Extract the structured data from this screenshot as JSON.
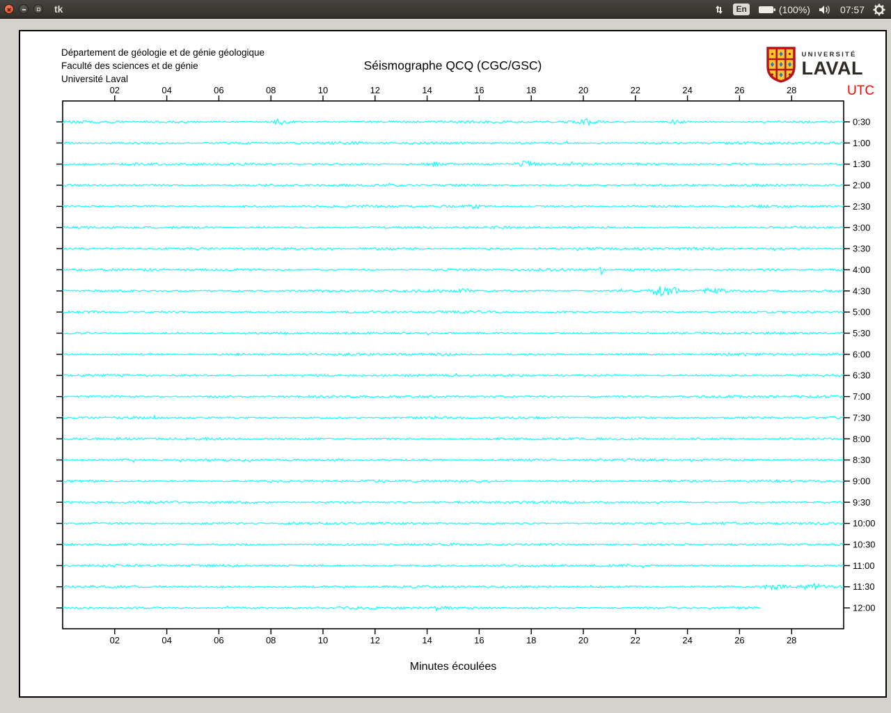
{
  "titlebar": {
    "title": "tk",
    "tray": {
      "keyboard_indicator": "En",
      "battery_label": "(100%)",
      "clock": "07:57"
    }
  },
  "header": {
    "institution_lines": [
      "Département de géologie et de génie géologique",
      "Faculté des sciences et de génie",
      "Université Laval"
    ],
    "logo": {
      "top": "UNIVERSITÉ",
      "bottom": "LAVAL"
    }
  },
  "chart_data": {
    "type": "line",
    "title": "Séismographe QCQ (CGC/GSC)",
    "xlabel": "Minutes écoulées",
    "right_axis_label": "UTC",
    "right_axis_label_color": "#ff0000",
    "trace_color": "#00ffff",
    "axis_color": "#000000",
    "x_range": [
      0,
      30
    ],
    "x_ticks": [
      "02",
      "04",
      "06",
      "08",
      "10",
      "12",
      "14",
      "16",
      "18",
      "20",
      "22",
      "24",
      "26",
      "28"
    ],
    "grid": false,
    "traces": [
      {
        "label": "0:30",
        "end_minute": 30
      },
      {
        "label": "1:00",
        "end_minute": 30
      },
      {
        "label": "1:30",
        "end_minute": 30
      },
      {
        "label": "2:00",
        "end_minute": 30
      },
      {
        "label": "2:30",
        "end_minute": 30
      },
      {
        "label": "3:00",
        "end_minute": 30
      },
      {
        "label": "3:30",
        "end_minute": 30
      },
      {
        "label": "4:00",
        "end_minute": 30
      },
      {
        "label": "4:30",
        "end_minute": 30
      },
      {
        "label": "5:00",
        "end_minute": 30
      },
      {
        "label": "5:30",
        "end_minute": 30
      },
      {
        "label": "6:00",
        "end_minute": 30
      },
      {
        "label": "6:30",
        "end_minute": 30
      },
      {
        "label": "7:00",
        "end_minute": 30
      },
      {
        "label": "7:30",
        "end_minute": 30
      },
      {
        "label": "8:00",
        "end_minute": 30
      },
      {
        "label": "8:30",
        "end_minute": 30
      },
      {
        "label": "9:00",
        "end_minute": 30
      },
      {
        "label": "9:30",
        "end_minute": 30
      },
      {
        "label": "10:00",
        "end_minute": 30
      },
      {
        "label": "10:30",
        "end_minute": 30
      },
      {
        "label": "11:00",
        "end_minute": 30
      },
      {
        "label": "11:30",
        "end_minute": 30
      },
      {
        "label": "12:00",
        "end_minute": 26.8
      }
    ],
    "events": [
      {
        "trace": 0,
        "minute": 8.4,
        "amp": 3.5,
        "sigma": 0.22
      },
      {
        "trace": 0,
        "minute": 20.2,
        "amp": 3.0,
        "sigma": 0.25
      },
      {
        "trace": 0,
        "minute": 23.5,
        "amp": 2.5,
        "sigma": 0.2
      },
      {
        "trace": 2,
        "minute": 14.2,
        "amp": 2.5,
        "sigma": 0.2
      },
      {
        "trace": 2,
        "minute": 17.8,
        "amp": 3.5,
        "sigma": 0.25
      },
      {
        "trace": 4,
        "minute": 15.8,
        "amp": 2.5,
        "sigma": 0.2
      },
      {
        "trace": 7,
        "minute": 20.7,
        "amp": 6.0,
        "sigma": 0.05
      },
      {
        "trace": 8,
        "minute": 15.4,
        "amp": 2.5,
        "sigma": 0.2
      },
      {
        "trace": 8,
        "minute": 22.9,
        "amp": 6.0,
        "sigma": 0.22
      },
      {
        "trace": 8,
        "minute": 23.4,
        "amp": 5.0,
        "sigma": 0.18
      },
      {
        "trace": 8,
        "minute": 25.0,
        "amp": 3.5,
        "sigma": 0.25
      },
      {
        "trace": 22,
        "minute": 27.3,
        "amp": 3.5,
        "sigma": 0.3
      },
      {
        "trace": 22,
        "minute": 28.8,
        "amp": 3.5,
        "sigma": 0.3
      }
    ]
  }
}
